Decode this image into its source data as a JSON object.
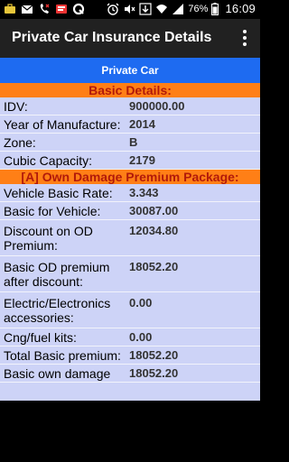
{
  "status_bar": {
    "battery_percent": "76%",
    "time": "16:09",
    "notification_icons": [
      "briefcase-icon",
      "email-icon",
      "missed-call-icon",
      "sms-icon",
      "q-app-icon"
    ],
    "system_icons": [
      "alarm-icon",
      "mute-icon",
      "download-icon",
      "wifi-icon",
      "signal-icon",
      "battery-icon"
    ]
  },
  "app_bar": {
    "title": "Private Car Insurance Details",
    "overflow_icon": "more-vert-icon"
  },
  "banner": "Private Car",
  "sections": {
    "basic": {
      "title": "Basic Details:",
      "rows": [
        {
          "label": "IDV:",
          "value": "900000.00"
        },
        {
          "label": "Year of Manufacture:",
          "value": "2014"
        },
        {
          "label": "Zone:",
          "value": "B"
        },
        {
          "label": "Cubic Capacity:",
          "value": "2179"
        }
      ]
    },
    "od": {
      "title": "[A] Own Damage Premium Package:",
      "rows": [
        {
          "label": "Vehicle Basic Rate:",
          "value": "3.343"
        },
        {
          "label": "Basic for Vehicle:",
          "value": "30087.00"
        },
        {
          "label": "Discount on OD Premium:",
          "value": "12034.80"
        },
        {
          "label": "Basic OD premium after discount:",
          "value": "18052.20"
        },
        {
          "label": "Electric/Electronics accessories:",
          "value": "0.00"
        },
        {
          "label": "Cng/fuel kits:",
          "value": "0.00"
        },
        {
          "label": "Total Basic premium:",
          "value": "18052.20"
        },
        {
          "label": "Basic own damage",
          "value": "18052.20"
        }
      ]
    }
  },
  "colors": {
    "banner": "#1e6bf1",
    "section_header": "#ff7f16",
    "section_text": "#b21a0a",
    "content_bg": "#cdd3f7",
    "app_bar": "#212121"
  }
}
